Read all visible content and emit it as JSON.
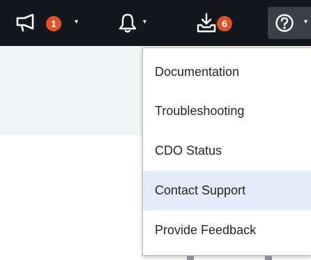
{
  "topbar": {
    "announcements_badge": "1",
    "downloads_badge": "6",
    "caret": "▾",
    "icons": {
      "announcements": "megaphone-icon",
      "notifications": "bell-icon",
      "downloads": "download-tray-icon",
      "help": "question-circle-icon"
    }
  },
  "help_menu": {
    "items": [
      {
        "label": "Documentation"
      },
      {
        "label": "Troubleshooting"
      },
      {
        "label": "CDO Status"
      },
      {
        "label": "Contact Support",
        "hovered": true
      },
      {
        "label": "Provide Feedback"
      }
    ]
  },
  "colors": {
    "topbar": "#14181c",
    "badge": "#e0532a",
    "hover": "#e3ecf8",
    "text": "#24272a"
  }
}
